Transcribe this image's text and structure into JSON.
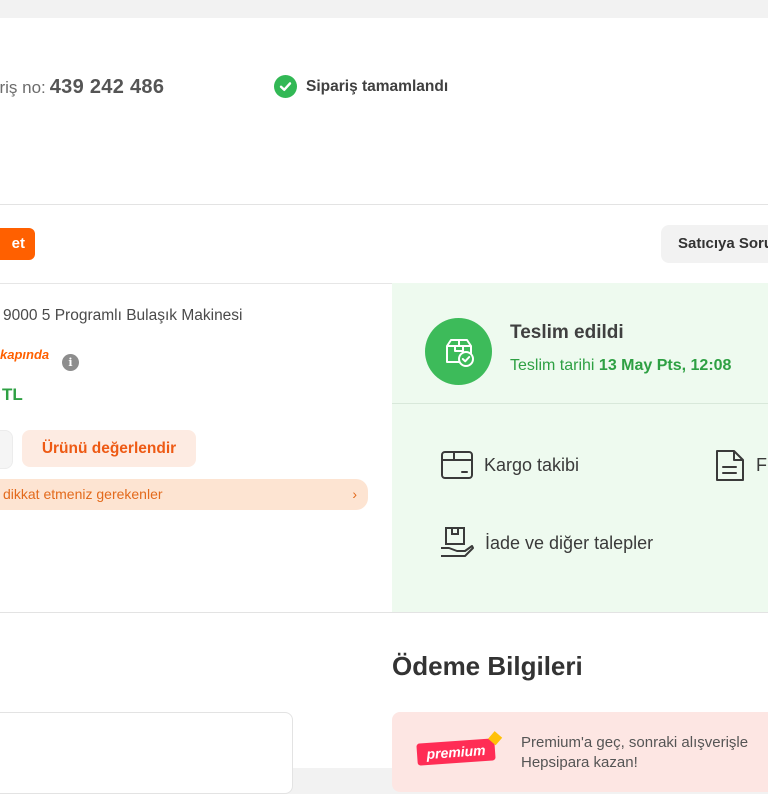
{
  "order": {
    "label": "ariş no:",
    "number": "439 242 486",
    "status": "Sipariş tamamlandı"
  },
  "seller": {
    "badge": "et",
    "ask_button": "Satıcıya Soru Sor"
  },
  "product": {
    "name": "9000 5 Programlı Bulaşık Makinesi",
    "delivery_badge": "kapında",
    "price": "TL",
    "rate_button": "Ürünü değerlendir",
    "warning": "dikkat etmeniz gerekenler",
    "warning_chevron": "›"
  },
  "delivery": {
    "title": "Teslim edildi",
    "date_label": "Teslim tarihi",
    "date_value": "13 May Pts, 12:08",
    "actions": [
      {
        "label": "Kargo takibi",
        "icon": "package-icon"
      },
      {
        "label": "F",
        "icon": "document-icon"
      },
      {
        "label": "İade ve diğer talepler",
        "icon": "return-box-icon"
      }
    ]
  },
  "payment": {
    "title": "Ödeme Bilgileri",
    "premium_logo": "premium",
    "premium_line1": "Premium'a geç, sonraki alışverişle",
    "premium_line2": "Hepsipara kazan!"
  },
  "colors": {
    "brand_orange": "#ff6000",
    "success_green": "#3dbb5a",
    "panel_green": "#eefaef",
    "premium_bg": "#fde6e3"
  }
}
